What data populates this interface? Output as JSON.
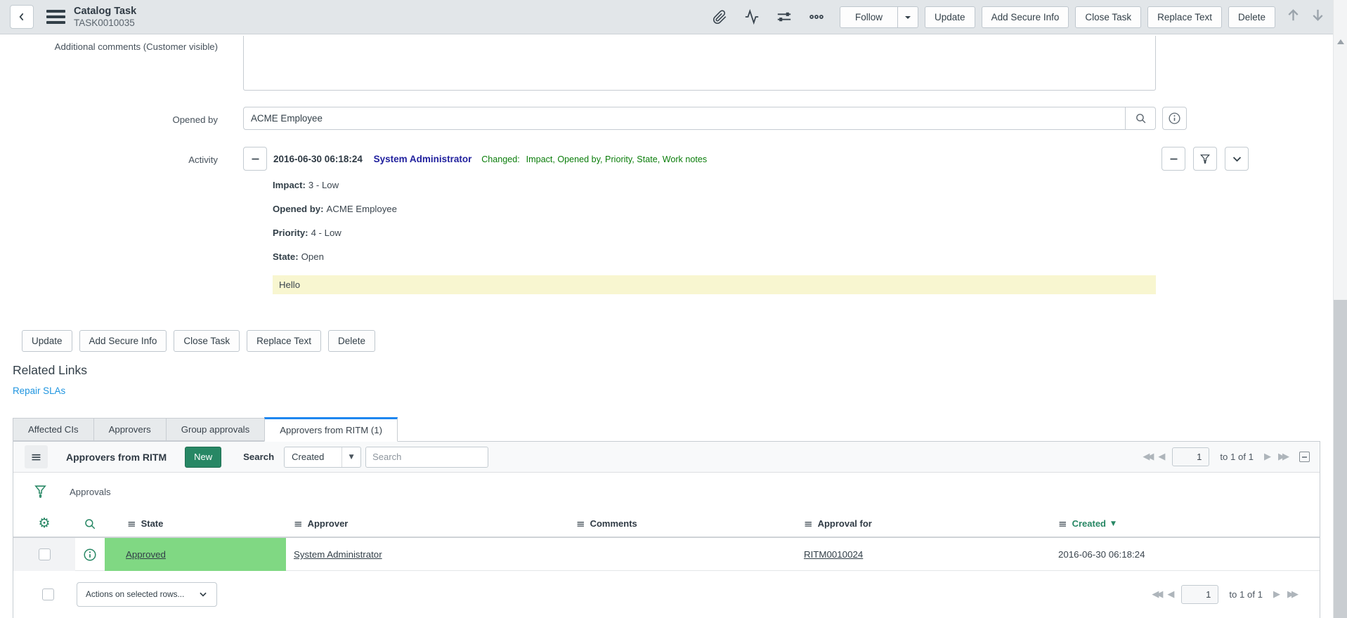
{
  "header": {
    "title": "Catalog Task",
    "record_id": "TASK0010035",
    "follow_label": "Follow",
    "actions": [
      "Update",
      "Add Secure Info",
      "Close Task",
      "Replace Text",
      "Delete"
    ]
  },
  "form": {
    "comments_label": "Additional comments (Customer visible)",
    "comments_value": "",
    "opened_by_label": "Opened by",
    "opened_by_value": "ACME Employee"
  },
  "activity": {
    "label": "Activity",
    "entry": {
      "timestamp": "2016-06-30 06:18:24",
      "user": "System Administrator",
      "changed_label": "Changed:",
      "changed_fields": "Impact, Opened by, Priority, State, Work notes"
    },
    "details": [
      {
        "label": "Impact:",
        "value": "3 - Low"
      },
      {
        "label": "Opened by:",
        "value": "ACME Employee"
      },
      {
        "label": "Priority:",
        "value": "4 - Low"
      },
      {
        "label": "State:",
        "value": "Open"
      }
    ],
    "work_note": "Hello"
  },
  "form_actions": [
    "Update",
    "Add Secure Info",
    "Close Task",
    "Replace Text",
    "Delete"
  ],
  "related_links": {
    "heading": "Related Links",
    "repair_link": "Repair SLAs"
  },
  "tabs": [
    {
      "label": "Affected CIs"
    },
    {
      "label": "Approvers"
    },
    {
      "label": "Group approvals"
    },
    {
      "label": "Approvers from RITM (1)"
    }
  ],
  "list": {
    "title": "Approvers from RITM",
    "new_label": "New",
    "search_label": "Search",
    "search_column": "Created",
    "search_placeholder": "Search",
    "breadcrumb": "Approvals",
    "pagination": {
      "page": "1",
      "range": "to 1 of 1"
    },
    "columns": [
      "State",
      "Approver",
      "Comments",
      "Approval for",
      "Created"
    ],
    "row": {
      "state": "Approved",
      "approver": "System Administrator",
      "comments": "",
      "approval_for": "RITM0010024",
      "created": "2016-06-30 06:18:24"
    },
    "actions_label": "Actions on selected rows..."
  },
  "colors": {
    "accent_teal": "#278764",
    "approved_green": "#80d883",
    "work_note_yellow": "#f8f6d0",
    "changed_text_green": "#0a7d0a",
    "user_link_navy": "#21219e",
    "related_link_blue": "#1f95e0",
    "active_tab_blue": "#1e86f0",
    "header_bar_gray": "#e2e6e9"
  }
}
